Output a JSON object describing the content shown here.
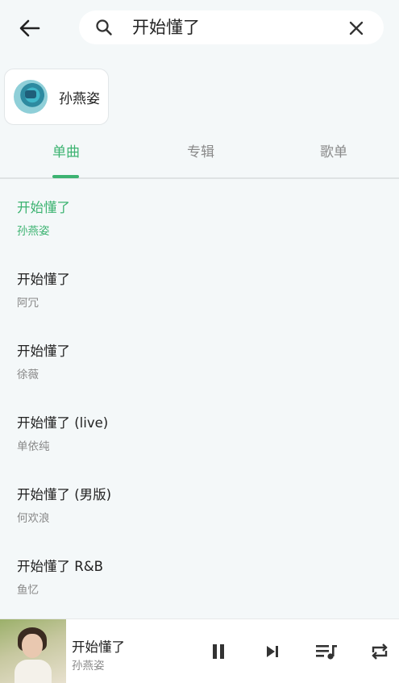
{
  "search": {
    "query": "开始懂了",
    "placeholder": ""
  },
  "artist_result": {
    "name": "孙燕姿"
  },
  "tabs": [
    {
      "label": "单曲",
      "active": true
    },
    {
      "label": "专辑",
      "active": false
    },
    {
      "label": "歌单",
      "active": false
    }
  ],
  "songs": [
    {
      "title": "开始懂了",
      "artist": "孙燕姿",
      "playing": true
    },
    {
      "title": "开始懂了",
      "artist": "阿冗",
      "playing": false
    },
    {
      "title": "开始懂了",
      "artist": "徐薇",
      "playing": false
    },
    {
      "title": "开始懂了 (live)",
      "artist": "单依纯",
      "playing": false
    },
    {
      "title": "开始懂了 (男版)",
      "artist": "何欢浪",
      "playing": false
    },
    {
      "title": "开始懂了 R&B",
      "artist": "鱼忆",
      "playing": false
    }
  ],
  "player": {
    "title": "开始懂了",
    "artist": "孙燕姿",
    "state": "playing"
  },
  "colors": {
    "accent": "#3cb371",
    "background": "#f4f8f9",
    "text_primary": "#222222",
    "text_secondary": "#888888"
  },
  "icons": {
    "back": "arrow-left-icon",
    "search": "search-icon",
    "clear": "close-icon",
    "pause": "pause-icon",
    "next": "skip-next-icon",
    "queue": "playlist-icon",
    "repeat": "repeat-icon"
  }
}
